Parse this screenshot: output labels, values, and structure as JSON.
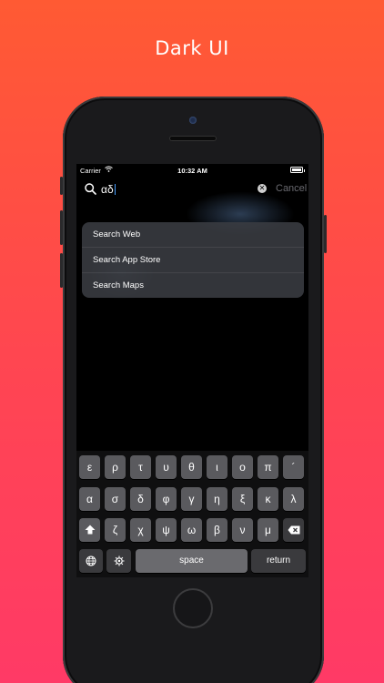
{
  "headline": "Dark UI",
  "status_bar": {
    "carrier": "Carrier",
    "time": "10:32 AM"
  },
  "search": {
    "query": "αδ",
    "cancel_label": "Cancel"
  },
  "suggestions": [
    {
      "label": "Search Web"
    },
    {
      "label": "Search App Store"
    },
    {
      "label": "Search Maps"
    }
  ],
  "keyboard": {
    "row1": [
      "ε",
      "ρ",
      "τ",
      "υ",
      "θ",
      "ι",
      "ο",
      "π",
      "´"
    ],
    "row2": [
      "α",
      "σ",
      "δ",
      "φ",
      "γ",
      "η",
      "ξ",
      "κ",
      "λ"
    ],
    "row3": [
      "ζ",
      "χ",
      "ψ",
      "ω",
      "β",
      "ν",
      "μ"
    ],
    "space_label": "space",
    "return_label": "return"
  },
  "icons": [
    "search-icon",
    "clear-icon",
    "wifi-icon",
    "battery-icon",
    "shift-icon",
    "delete-icon",
    "globe-icon",
    "gear-icon"
  ],
  "colors": {
    "gradient_top": "#ff5a33",
    "gradient_bottom": "#ff3a66",
    "caret": "#4aa0ff"
  }
}
